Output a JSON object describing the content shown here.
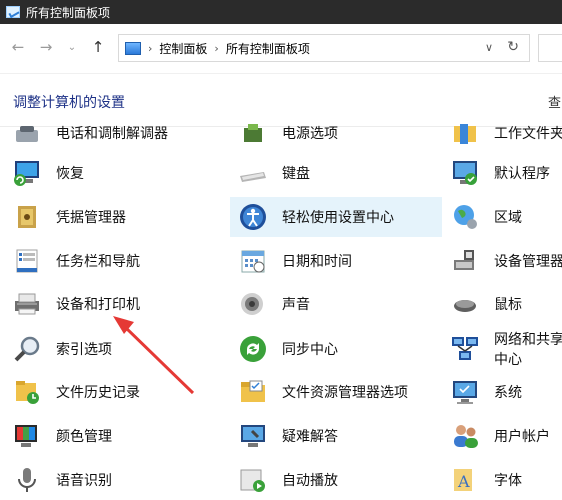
{
  "window": {
    "title": "所有控制面板项"
  },
  "nav": {
    "back_icon": "back-arrow-icon",
    "forward_icon": "forward-arrow-icon",
    "up_icon": "up-arrow-icon",
    "breadcrumb": [
      "控制面板",
      "所有控制面板项"
    ]
  },
  "header": {
    "title": "调整计算机的设置",
    "view_by_fragment": "查"
  },
  "items": {
    "r0": [
      "电话和调制解调器",
      "电源选项",
      "工作文件夹"
    ],
    "r1": [
      "恢复",
      "键盘",
      "默认程序"
    ],
    "r2": [
      "凭据管理器",
      "轻松使用设置中心",
      "区域"
    ],
    "r3": [
      "任务栏和导航",
      "日期和时间",
      "设备管理器"
    ],
    "r4": [
      "设备和打印机",
      "声音",
      "鼠标"
    ],
    "r5": [
      "索引选项",
      "同步中心",
      "网络和共享中心"
    ],
    "r6": [
      "文件历史记录",
      "文件资源管理器选项",
      "系统"
    ],
    "r7": [
      "颜色管理",
      "疑难解答",
      "用户帐户"
    ],
    "r8": [
      "语音识别",
      "自动播放",
      "字体"
    ]
  },
  "icons": {
    "r0": [
      "phone-modem-icon",
      "power-options-icon",
      "work-folders-icon"
    ],
    "r1": [
      "recovery-icon",
      "keyboard-icon",
      "default-programs-icon"
    ],
    "r2": [
      "credential-manager-icon",
      "ease-of-access-icon",
      "region-icon"
    ],
    "r3": [
      "taskbar-navigation-icon",
      "date-time-icon",
      "device-manager-icon"
    ],
    "r4": [
      "devices-printers-icon",
      "sound-icon",
      "mouse-icon"
    ],
    "r5": [
      "indexing-options-icon",
      "sync-center-icon",
      "network-sharing-icon"
    ],
    "r6": [
      "file-history-icon",
      "file-explorer-options-icon",
      "system-icon"
    ],
    "r7": [
      "color-management-icon",
      "troubleshooting-icon",
      "user-accounts-icon"
    ],
    "r8": [
      "speech-recognition-icon",
      "autoplay-icon",
      "fonts-icon"
    ]
  },
  "annotation": {
    "color": "#e53935"
  },
  "colors": {
    "titlebar": "#2b2b2b",
    "header_text": "#1e3287",
    "highlight": "#e5f3fb"
  }
}
